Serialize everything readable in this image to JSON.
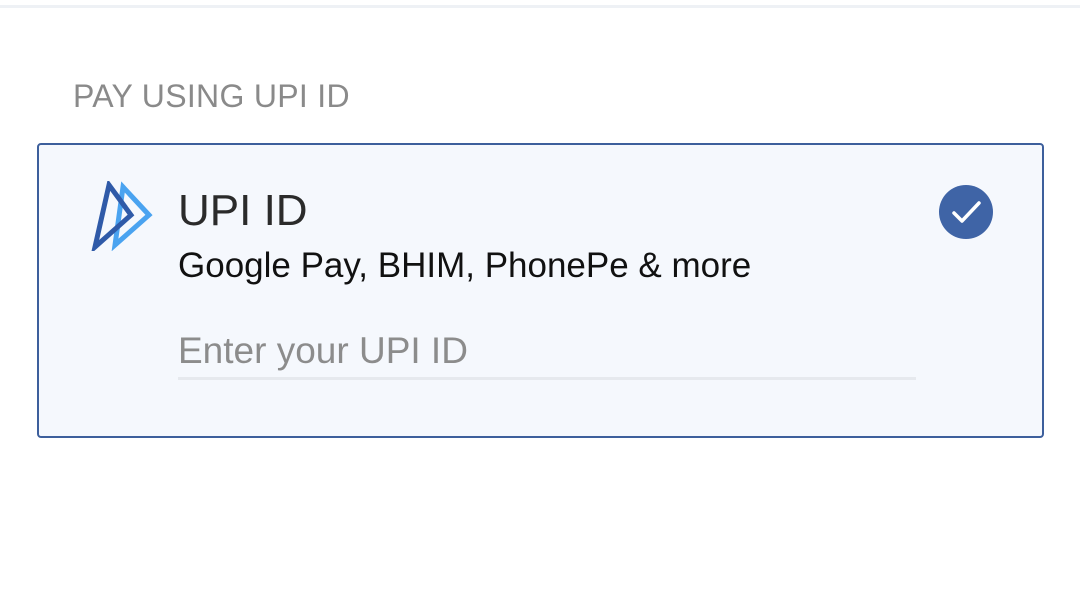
{
  "section": {
    "heading": "PAY USING UPI ID"
  },
  "upi_option": {
    "title": "UPI ID",
    "subtitle": "Google Pay, BHIM, PhonePe & more",
    "logo_icon": "upi-logo-icon",
    "selected": true,
    "selected_icon": "check-circle-icon",
    "input": {
      "placeholder": "Enter your UPI ID",
      "value": ""
    }
  },
  "colors": {
    "accent": "#3f64a6",
    "card_border": "#3d5f9c",
    "card_background": "#f5f8fd",
    "logo_dark": "#2f5aa8",
    "logo_light": "#4aa3f0",
    "heading_text": "#8a8a8a"
  }
}
